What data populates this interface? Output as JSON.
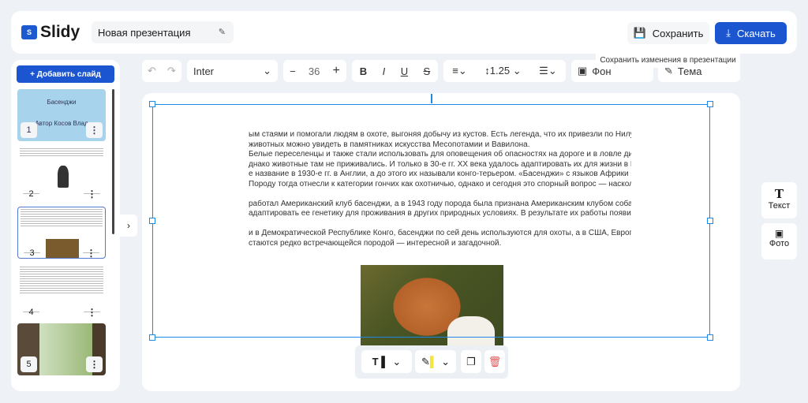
{
  "app": {
    "name": "Slidy",
    "logo_mark": "S",
    "presentation_title": "Новая презентация"
  },
  "header": {
    "save_label": "Сохранить",
    "download_label": "Скачать",
    "tooltip": "Сохранить изменения в презентации"
  },
  "toolbar": {
    "font": "Inter",
    "font_size": "36",
    "line_height": "1.25",
    "background_label": "Фон",
    "theme_label": "Тема"
  },
  "sidebar": {
    "add_slide_label": "+ Добавить слайд",
    "slides": [
      {
        "number": "1",
        "title": "Басенджи",
        "subtitle": "Автор Косов Влад"
      },
      {
        "number": "2"
      },
      {
        "number": "3"
      },
      {
        "number": "4"
      },
      {
        "number": "5"
      }
    ]
  },
  "slide": {
    "lines": [
      "ым стаями и помогали людям в охоте, выгоняя добычу из кустов. Есть легенда, что их привезли по Нилу как",
      "животных можно увидеть в памятниках искусства Месопотамии и Вавилона.",
      "Белые переселенцы и также стали использовать для оповещения об опасностях на дороге и в ловле дичи. И",
      "днако животные там не приживались. И только в 30-е гг. XX века удалось адаптировать их для жизни в Вел",
      "е название в 1930-е гг. в Англии, а до этого их называли конго-терьером. «Басенджи» с языков Африки пер",
      "Породу тогда отнесли к категории гончих как охотничью, однако и сегодня это спорный вопрос — насколько",
      "",
      "работал Американский клуб басенджи, а в 1943 году порода была признана Американским клубом собаков",
      "адаптировать ее генетику для проживания в других природных условиях. В результате их работы появились",
      "",
      "и в Демократической Республике Конго, басенджи по сей день используются для охоты, а в США, Европе и",
      "стаются редко встречающейся породой — интересной и загадочной."
    ]
  },
  "right_panel": {
    "text_label": "Текст",
    "photo_label": "Фото"
  },
  "colors": {
    "accent": "#1b56d0",
    "selection": "#1e88e5",
    "delete": "#e05555"
  }
}
